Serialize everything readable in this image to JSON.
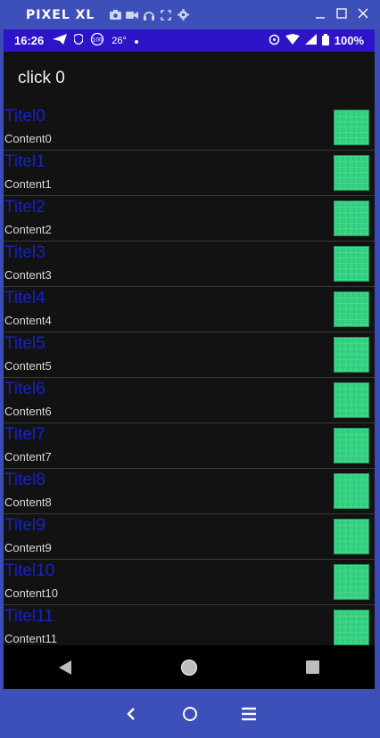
{
  "emulator": {
    "title": "PIXEL XL",
    "toolbar_icons": [
      "camera-icon",
      "video-icon",
      "headphones-icon",
      "fullscreen-icon",
      "settings-icon"
    ],
    "window_controls": [
      "minimize-icon",
      "maximize-icon",
      "close-icon"
    ],
    "bottom_nav_icons": [
      "back-chevron-icon",
      "home-circle-icon",
      "menu-icon"
    ]
  },
  "statusbar": {
    "time": "16:26",
    "temperature": "26°",
    "battery": "100%",
    "colors": {
      "background": "#2e14c9"
    }
  },
  "header": {
    "click_label": "click 0"
  },
  "list": {
    "items": [
      {
        "title": "Titel0",
        "content": "Content0"
      },
      {
        "title": "Titel1",
        "content": "Content1"
      },
      {
        "title": "Titel2",
        "content": "Content2"
      },
      {
        "title": "Titel3",
        "content": "Content3"
      },
      {
        "title": "Titel4",
        "content": "Content4"
      },
      {
        "title": "Titel5",
        "content": "Content5"
      },
      {
        "title": "Titel6",
        "content": "Content6"
      },
      {
        "title": "Titel7",
        "content": "Content7"
      },
      {
        "title": "Titel8",
        "content": "Content8"
      },
      {
        "title": "Titel9",
        "content": "Content9"
      },
      {
        "title": "Titel10",
        "content": "Content10"
      },
      {
        "title": "Titel11",
        "content": "Content11"
      }
    ],
    "colors": {
      "title": "#1722c8",
      "thumb": "#2fcf7d"
    }
  }
}
